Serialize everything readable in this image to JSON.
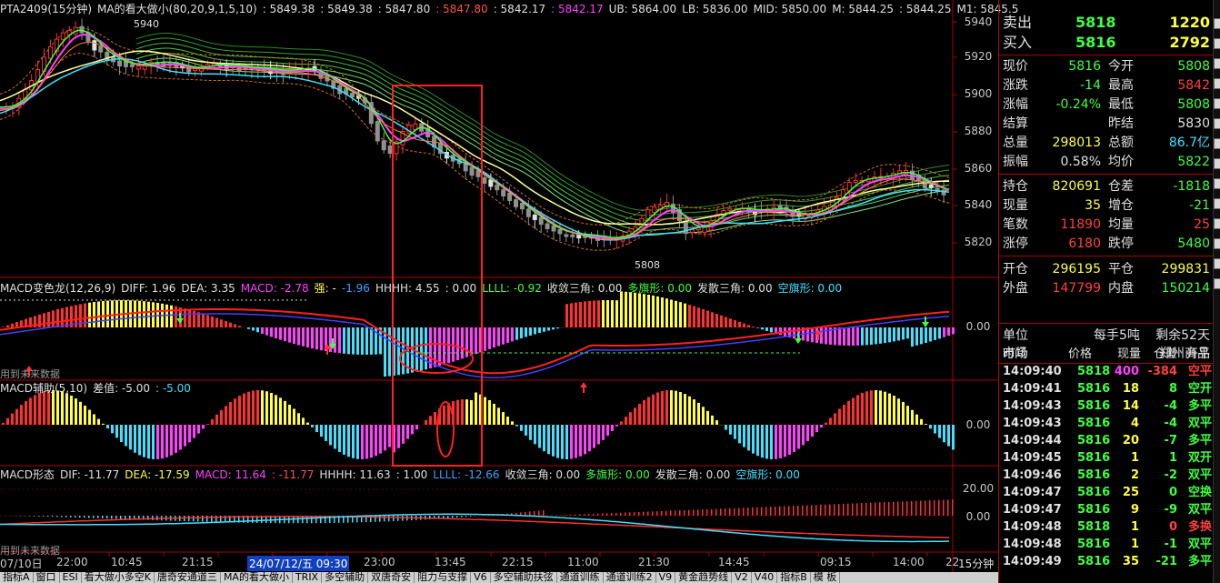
{
  "main_header": {
    "items": [
      {
        "text": "PTA2409(15分钟)",
        "color": "#e0e0e0"
      },
      {
        "text": "MA的看大做小(80,20,9,1,5,10)",
        "color": "#e0e0e0"
      },
      {
        "text": ": 5849.38",
        "color": "#e0e0e0"
      },
      {
        "text": ": 5849.38",
        "color": "#e0e0e0"
      },
      {
        "text": ": 5847.80",
        "color": "#e0e0e0"
      },
      {
        "text": ": 5847.80",
        "color": "#ff5050"
      },
      {
        "text": ": 5842.17",
        "color": "#e0e0e0"
      },
      {
        "text": ": 5842.17",
        "color": "#ff40ff"
      },
      {
        "text": "UB: 5864.00",
        "color": "#e0e0e0"
      },
      {
        "text": "LB: 5836.00",
        "color": "#e0e0e0"
      },
      {
        "text": "MID: 5850.00",
        "color": "#e0e0e0"
      },
      {
        "text": "M: 5844.25",
        "color": "#e0e0e0"
      },
      {
        "text": ": 5844.25",
        "color": "#e0e0e0"
      },
      {
        "text": "M1: 5845.5",
        "color": "#e0e0e0"
      }
    ]
  },
  "main_annotations": {
    "high": "5940",
    "low": "5808"
  },
  "price_axis": [
    "5940",
    "5920",
    "5900",
    "5880",
    "5860",
    "5840",
    "5820"
  ],
  "macd1_header": {
    "items": [
      {
        "text": "MACD变色龙(12,26,9)",
        "color": "#e0e0e0"
      },
      {
        "text": "DIFF: 1.96",
        "color": "#e0e0e0"
      },
      {
        "text": "DEA: 3.35",
        "color": "#e0e0e0"
      },
      {
        "text": "MACD: -2.78",
        "color": "#ff40ff"
      },
      {
        "text": "强: -",
        "color": "#ffff40"
      },
      {
        "text": "-1.96",
        "color": "#40a0ff"
      },
      {
        "text": "HHHH: 4.55",
        "color": "#e0e0e0"
      },
      {
        "text": ": 0.00",
        "color": "#e0e0e0"
      },
      {
        "text": "LLLL: -0.92",
        "color": "#40ff40"
      },
      {
        "text": "收敛三角: 0.00",
        "color": "#e0e0e0"
      },
      {
        "text": "多旗形: 0.00",
        "color": "#40ff40"
      },
      {
        "text": "发散三角: 0.00",
        "color": "#e0e0e0"
      },
      {
        "text": "空旗形: 0.00",
        "color": "#40e0ff"
      }
    ]
  },
  "macd1_note": "用到未来数据",
  "macd1_axis": "0.00",
  "macd2_header": {
    "items": [
      {
        "text": "MACD辅助(5,10)",
        "color": "#e0e0e0"
      },
      {
        "text": "差值: -5.00",
        "color": "#e0e0e0"
      },
      {
        "text": ": -5.00",
        "color": "#40e0ff"
      }
    ]
  },
  "macd2_axis": "0.00",
  "macd3_header": {
    "items": [
      {
        "text": "MACD形态",
        "color": "#e0e0e0"
      },
      {
        "text": "DIF: -11.77",
        "color": "#e0e0e0"
      },
      {
        "text": "DEA: -17.59",
        "color": "#ffff40"
      },
      {
        "text": "MACD: 11.64",
        "color": "#ff40ff"
      },
      {
        "text": ": -11.77",
        "color": "#ff5050"
      },
      {
        "text": "HHHH: 11.63",
        "color": "#e0e0e0"
      },
      {
        "text": ": 1.00",
        "color": "#e0e0e0"
      },
      {
        "text": "LLLL: -12.66",
        "color": "#40a0ff"
      },
      {
        "text": "收敛三角: 0.00",
        "color": "#e0e0e0"
      },
      {
        "text": "多旗形: 0.00",
        "color": "#40ff40"
      },
      {
        "text": "发散三角: 0.00",
        "color": "#e0e0e0"
      },
      {
        "text": "空旗形: 0.00",
        "color": "#40e0ff"
      }
    ]
  },
  "macd3_note": "用到未来数据",
  "macd3_axis": [
    "20.00",
    "0.00"
  ],
  "time_axis": [
    "07/10日",
    "22:00",
    "10:45",
    "21:15",
    "24/07/12/五 09:30",
    "23:00",
    "13:45",
    "22:15",
    "11:00",
    "21:30",
    "14:45",
    "09:15",
    "14:00",
    "22"
  ],
  "period_label": "15分钟",
  "tabs": [
    "指标A",
    "窗口",
    "ESI",
    "看大做小多空K",
    "唐奇安通道三",
    "MA的看大做小",
    "TRIX",
    "多空辅助",
    "双唐奇安",
    "阻力与支撑",
    "V6",
    "多空辅助扶弦",
    "通道训练",
    "通道训练2",
    "V9",
    "黄金趋势线",
    "V2",
    "V40",
    "指标B",
    "模 板"
  ],
  "quote": {
    "sell_label": "卖出",
    "sell_price": "5818",
    "sell_vol": "1220",
    "buy_label": "买入",
    "buy_price": "5816",
    "buy_vol": "2792",
    "rows": [
      {
        "l1": "现价",
        "v1": "5816",
        "c1": "#40ff40",
        "l2": "今开",
        "v2": "5808",
        "c2": "#40ff40"
      },
      {
        "l1": "涨跌",
        "v1": "-14",
        "c1": "#40ff40",
        "l2": "最高",
        "v2": "5842",
        "c2": "#ff4040"
      },
      {
        "l1": "涨幅",
        "v1": "-0.24%",
        "c1": "#40ff40",
        "l2": "最低",
        "v2": "5808",
        "c2": "#40ff40"
      },
      {
        "l1": "结算",
        "v1": "",
        "c1": "#e0e0e0",
        "l2": "昨结",
        "v2": "5830",
        "c2": "#e0e0e0"
      },
      {
        "l1": "总量",
        "v1": "298013",
        "c1": "#ffff40",
        "l2": "总额",
        "v2": "86.7亿",
        "c2": "#40e0ff"
      },
      {
        "l1": "振幅",
        "v1": "0.58%",
        "c1": "#e0e0e0",
        "l2": "均价",
        "v2": "5822",
        "c2": "#40ff40"
      },
      {
        "l1": "持仓",
        "v1": "820691",
        "c1": "#ffff40",
        "l2": "仓差",
        "v2": "-1818",
        "c2": "#40ff40"
      },
      {
        "l1": "现量",
        "v1": "35",
        "c1": "#ffff40",
        "l2": "增仓",
        "v2": "-21",
        "c2": "#40ff40"
      },
      {
        "l1": "笔数",
        "v1": "11890",
        "c1": "#ff4040",
        "l2": "均量",
        "v2": "25",
        "c2": "#ff4040"
      },
      {
        "l1": "涨停",
        "v1": "6180",
        "c1": "#ff4040",
        "l2": "跌停",
        "v2": "5480",
        "c2": "#40ff40"
      },
      {
        "l1": "开仓",
        "v1": "296195",
        "c1": "#ffff40",
        "l2": "平仓",
        "v2": "299831",
        "c2": "#ffff40"
      },
      {
        "l1": "外盘",
        "v1": "147799",
        "c1": "#ff4040",
        "l2": "内盘",
        "v2": "150214",
        "c2": "#40ff40"
      }
    ],
    "unit_label": "单位",
    "unit_value": "每手5吨",
    "remain": "剩余52天",
    "market_label": "市场",
    "market_value": "郑州商品"
  },
  "ticks_header": {
    "time": "时间",
    "price": "价格",
    "vol": "现量",
    "oi": "仓差",
    "type": "开平"
  },
  "ticks": [
    {
      "time": "14:09:40",
      "price": "5818",
      "vol": "400",
      "oi": "-384",
      "type": "空平",
      "pc": "#40ff40",
      "vc": "#ff40ff",
      "oc": "#ff4040",
      "tc": "#ff4040"
    },
    {
      "time": "14:09:41",
      "price": "5816",
      "vol": "18",
      "oi": "8",
      "type": "空开",
      "pc": "#40ff40",
      "vc": "#ffff40",
      "oc": "#40ff40",
      "tc": "#40ff40"
    },
    {
      "time": "14:09:43",
      "price": "5816",
      "vol": "14",
      "oi": "-4",
      "type": "多平",
      "pc": "#40ff40",
      "vc": "#ffff40",
      "oc": "#40ff40",
      "tc": "#40ff40"
    },
    {
      "time": "14:09:43",
      "price": "5816",
      "vol": "4",
      "oi": "-4",
      "type": "双平",
      "pc": "#40ff40",
      "vc": "#ffff40",
      "oc": "#40ff40",
      "tc": "#40ff40"
    },
    {
      "time": "14:09:44",
      "price": "5816",
      "vol": "20",
      "oi": "-7",
      "type": "多平",
      "pc": "#40ff40",
      "vc": "#ffff40",
      "oc": "#40ff40",
      "tc": "#40ff40"
    },
    {
      "time": "14:09:45",
      "price": "5816",
      "vol": "1",
      "oi": "1",
      "type": "双开",
      "pc": "#40ff40",
      "vc": "#ffff40",
      "oc": "#40ff40",
      "tc": "#40ff40"
    },
    {
      "time": "14:09:46",
      "price": "5816",
      "vol": "2",
      "oi": "-2",
      "type": "双平",
      "pc": "#40ff40",
      "vc": "#ffff40",
      "oc": "#40ff40",
      "tc": "#40ff40"
    },
    {
      "time": "14:09:47",
      "price": "5816",
      "vol": "25",
      "oi": "0",
      "type": "空换",
      "pc": "#40ff40",
      "vc": "#ffff40",
      "oc": "#40ff40",
      "tc": "#40ff40"
    },
    {
      "time": "14:09:47",
      "price": "5816",
      "vol": "9",
      "oi": "-9",
      "type": "双平",
      "pc": "#40ff40",
      "vc": "#ffff40",
      "oc": "#40ff40",
      "tc": "#40ff40"
    },
    {
      "time": "14:09:48",
      "price": "5818",
      "vol": "1",
      "oi": "0",
      "type": "多换",
      "pc": "#40ff40",
      "vc": "#ffff40",
      "oc": "#ff4040",
      "tc": "#ff4040"
    },
    {
      "time": "14:09:48",
      "price": "5816",
      "vol": "1",
      "oi": "-1",
      "type": "双平",
      "pc": "#40ff40",
      "vc": "#ffff40",
      "oc": "#40ff40",
      "tc": "#40ff40"
    },
    {
      "time": "14:09:49",
      "price": "5816",
      "vol": "35",
      "oi": "-21",
      "type": "多平",
      "pc": "#40ff40",
      "vc": "#ffff40",
      "oc": "#40ff40",
      "tc": "#40ff40"
    }
  ]
}
